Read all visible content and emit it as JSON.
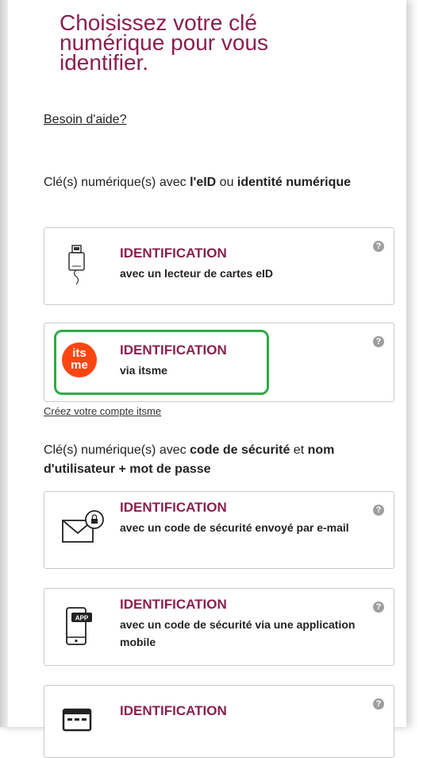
{
  "title": "Choisissez votre clé numérique pour vous identifier.",
  "help_link": "Besoin d'aide?",
  "section1": {
    "prefix": "Clé(s) numérique(s) avec ",
    "bold1": "l'eID",
    "middle": " ou ",
    "bold2": "identité numérique"
  },
  "cards": [
    {
      "heading": "IDENTIFICATION",
      "desc": "avec un lecteur de cartes eID",
      "icon": "card-reader-icon"
    },
    {
      "heading": "IDENTIFICATION",
      "desc": "via itsme",
      "icon": "itsme-logo",
      "logo_top": "its",
      "logo_bottom": "me"
    },
    {
      "heading": "IDENTIFICATION",
      "desc": "avec un code de sécurité envoyé par e-mail",
      "icon": "email-lock-icon"
    },
    {
      "heading": "IDENTIFICATION",
      "desc": "avec un code de sécurité via une application mobile",
      "icon": "mobile-app-icon",
      "badge": "APP"
    },
    {
      "heading": "IDENTIFICATION",
      "desc": "",
      "icon": "keyboard-icon"
    }
  ],
  "create_account_link": "Créez votre compte itsme",
  "section2": {
    "prefix": "Clé(s) numérique(s) avec ",
    "bold1": "code de sécurité",
    "middle": " et ",
    "bold2": "nom d'utilisateur + mot de passe"
  },
  "help_icon_text": "?",
  "colors": {
    "accent": "#8b1f4f",
    "itsme": "#ff4612",
    "highlight": "#2fab48"
  }
}
